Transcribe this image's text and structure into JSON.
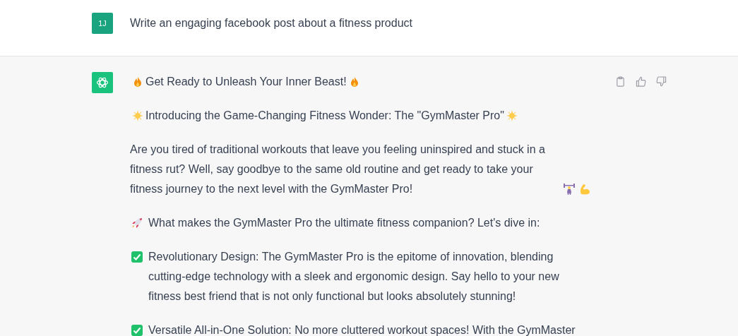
{
  "user_message": {
    "avatar": "1J",
    "text": "Write an engaging facebook post about a fitness product"
  },
  "assistant_message": {
    "paragraphs": [
      {
        "kind": "headline",
        "text": "Get Ready to Unleash Your Inner Beast!"
      },
      {
        "kind": "intro",
        "text": "Introducing the Game-Changing Fitness Wonder: The \"GymMaster Pro\""
      },
      {
        "kind": "body",
        "text": "Are you tired of traditional workouts that leave you feeling uninspired and stuck in a fitness rut? Well, say goodbye to the same old routine and get ready to take your fitness journey to the next level with the GymMaster Pro!"
      },
      {
        "kind": "question",
        "text": "What makes the GymMaster Pro the ultimate fitness companion? Let's dive in:"
      },
      {
        "kind": "feature",
        "text": "Revolutionary Design: The GymMaster Pro is the epitome of innovation, blending cutting-edge technology with a sleek and ergonomic design. Say hello to your new fitness best friend that is not only functional but looks absolutely stunning!"
      },
      {
        "kind": "feature",
        "text": "Versatile All-in-One Solution: No more cluttered workout spaces! With the GymMaster"
      }
    ]
  }
}
